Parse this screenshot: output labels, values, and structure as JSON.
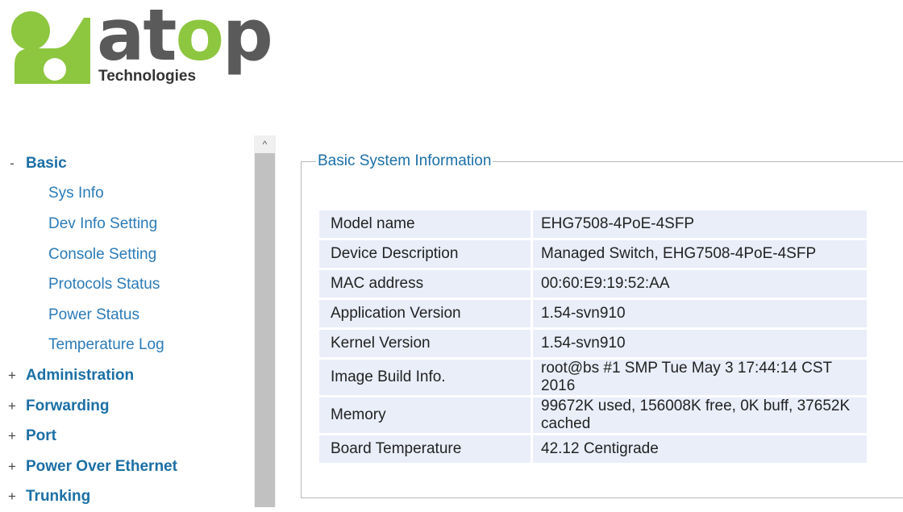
{
  "logo": {
    "word_a": "at",
    "word_o": "o",
    "word_p": "p",
    "subtitle": "Technologies",
    "colors": {
      "mark": "#8dc63f",
      "word": "#5a5a5a"
    }
  },
  "nav": {
    "basic": {
      "sign": "-",
      "label": "Basic"
    },
    "basic_items": [
      "Sys Info",
      "Dev Info Setting",
      "Console Setting",
      "Protocols Status",
      "Power Status",
      "Temperature Log"
    ],
    "sections": [
      {
        "sign": "+",
        "label": "Administration"
      },
      {
        "sign": "+",
        "label": "Forwarding"
      },
      {
        "sign": "+",
        "label": "Port"
      },
      {
        "sign": "+",
        "label": "Power Over Ethernet"
      },
      {
        "sign": "+",
        "label": "Trunking"
      }
    ]
  },
  "scrollbar": {
    "up_arrow": "^"
  },
  "panel": {
    "legend": "Basic System Information",
    "rows": [
      {
        "key": "Model name",
        "value": "EHG7508-4PoE-4SFP"
      },
      {
        "key": "Device Description",
        "value": "Managed Switch, EHG7508-4PoE-4SFP"
      },
      {
        "key": "MAC address",
        "value": "00:60:E9:19:52:AA"
      },
      {
        "key": "Application Version",
        "value": "1.54-svn910"
      },
      {
        "key": "Kernel Version",
        "value": "1.54-svn910"
      },
      {
        "key": "Image Build Info.",
        "value": "root@bs #1 SMP Tue May 3 17:44:14 CST 2016"
      },
      {
        "key": "Memory",
        "value": "99672K used, 156008K free, 0K buff, 37652K cached"
      },
      {
        "key": "Board Temperature",
        "value": "42.12 Centigrade"
      }
    ]
  }
}
